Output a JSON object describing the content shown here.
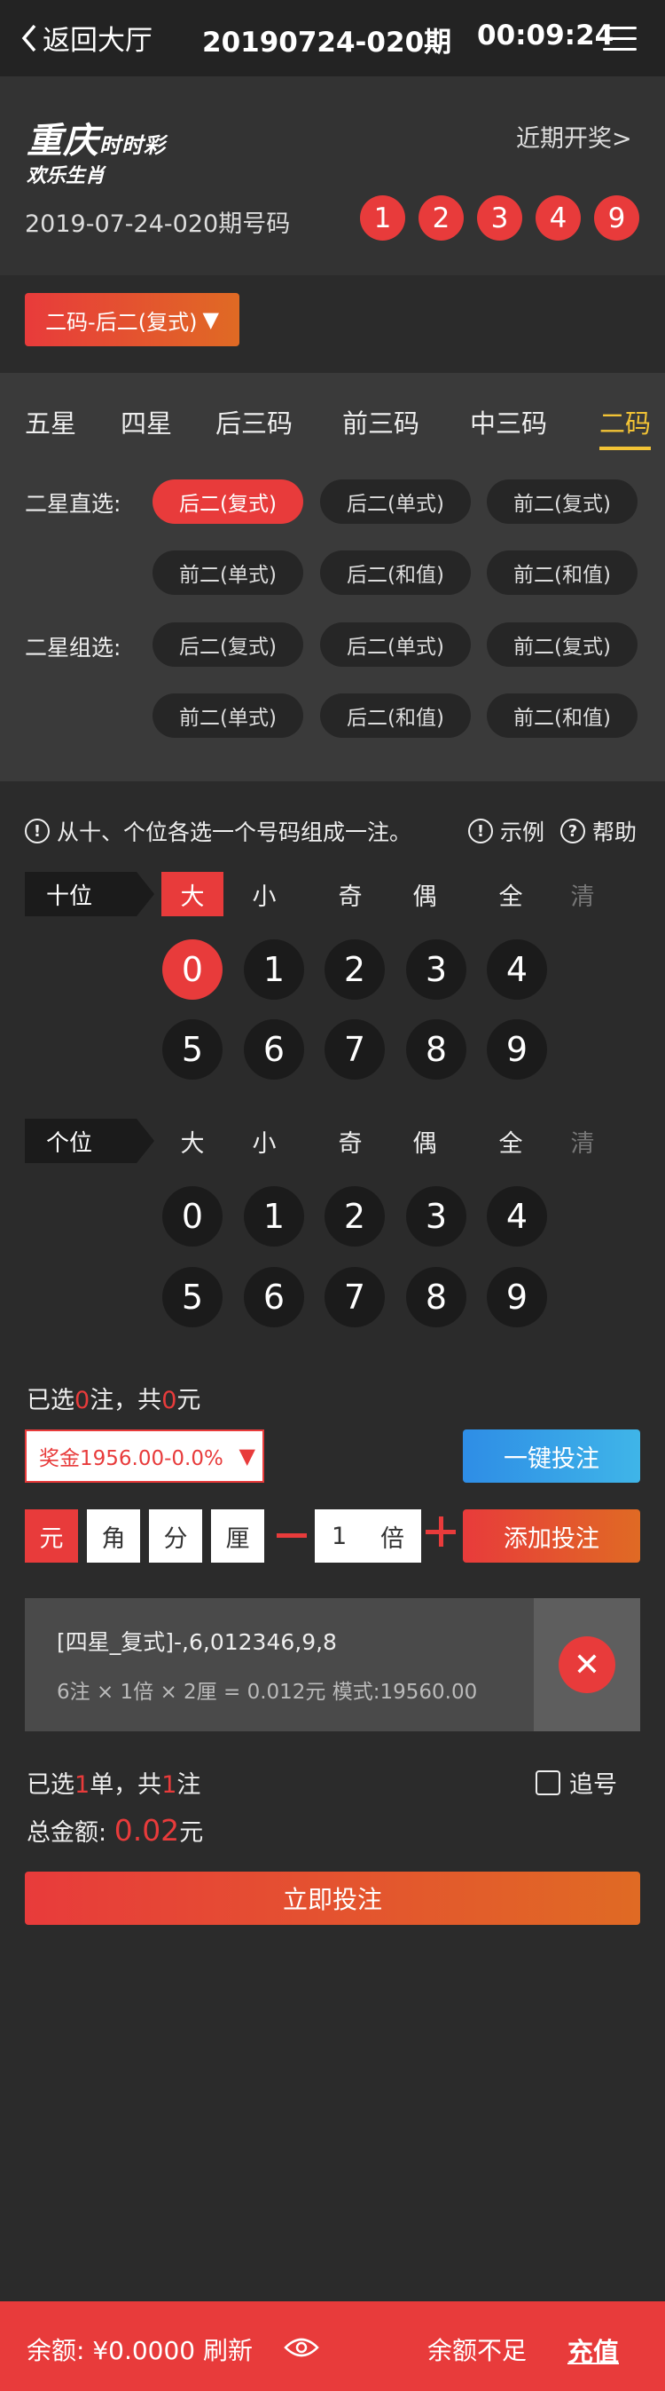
{
  "topbar": {
    "back_label": "返回大厅",
    "title": "20190724-020期",
    "timer": "00:09:24"
  },
  "header": {
    "logo_main": "重庆",
    "logo_sub": "时时彩",
    "logo_tagline": "欢乐生肖",
    "recent_label": "近期开奖>",
    "issue_label": "2019-07-24-020期号码",
    "numbers": [
      "1",
      "2",
      "3",
      "4",
      "9"
    ]
  },
  "mode_button": {
    "label": "二码-后二(复式)",
    "arrow": "▼"
  },
  "tabs": [
    "五星",
    "四星",
    "后三码",
    "前三码",
    "中三码",
    "二码"
  ],
  "active_tab": "二码",
  "rows": {
    "direct_label": "二星直选:",
    "group_label": "二星组选:",
    "direct": [
      "后二(复式)",
      "后二(单式)",
      "前二(复式)",
      "前二(单式)",
      "后二(和值)",
      "前二(和值)"
    ],
    "group": [
      "后二(复式)",
      "后二(单式)",
      "前二(复式)",
      "前二(单式)",
      "后二(和值)",
      "前二(和值)"
    ]
  },
  "hint": {
    "text": "从十、个位各选一个号码组成一注。",
    "example": "示例",
    "help": "帮助"
  },
  "positions": [
    {
      "label": "十位",
      "quick": [
        "大",
        "小",
        "奇",
        "偶",
        "全",
        "清"
      ],
      "digits": [
        "0",
        "1",
        "2",
        "3",
        "4",
        "5",
        "6",
        "7",
        "8",
        "9"
      ]
    },
    {
      "label": "个位",
      "quick": [
        "大",
        "小",
        "奇",
        "偶",
        "全",
        "清"
      ],
      "digits": [
        "0",
        "1",
        "2",
        "3",
        "4",
        "5",
        "6",
        "7",
        "8",
        "9"
      ]
    }
  ],
  "selection": {
    "prefix": "已选",
    "count": "0",
    "mid": "注，共",
    "amount": "0",
    "suffix": "元"
  },
  "prize_select": "奖金1956.00-0.0%",
  "one_key": "一键投注",
  "units": [
    "元",
    "角",
    "分",
    "厘"
  ],
  "multiplier": {
    "value": "1",
    "unit": "倍"
  },
  "add_bet": "添加投注",
  "bet_item": {
    "line1": "[四星_复式]-,6,012346,9,8",
    "line2": "6注 × 1倍 × 2厘 = 0.012元     模式:19560.00"
  },
  "summary": {
    "prefix": "已选",
    "orders": "1",
    "mid": "单，共",
    "bets": "1",
    "suffix": "注",
    "chase": "追号",
    "total_label": "总金额:",
    "total": "0.02",
    "total_unit": "元"
  },
  "submit": "立即投注",
  "footer": {
    "balance": "余额: ¥0.0000 刷新",
    "insufficient": "余额不足",
    "recharge": "充值"
  },
  "colors": {
    "accent": "#e83b3b",
    "tab_active": "#f2c335",
    "blue": "#2e8de6"
  }
}
